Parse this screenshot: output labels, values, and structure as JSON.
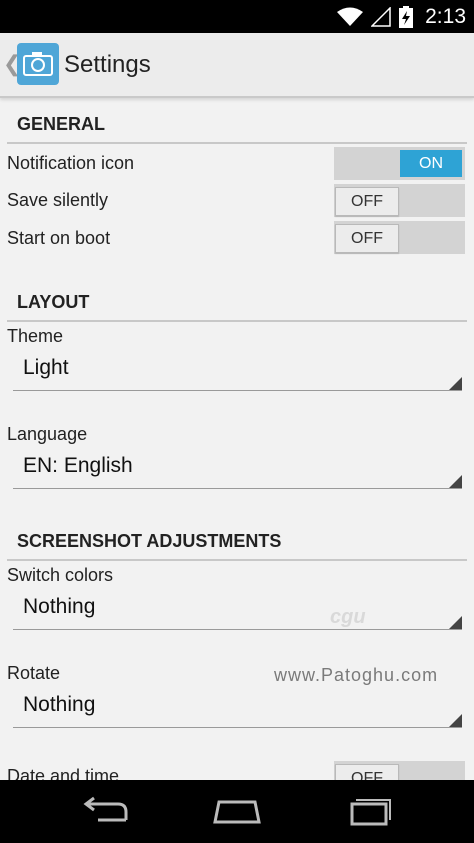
{
  "status_bar": {
    "time": "2:13",
    "icons": [
      "wifi-icon",
      "signal-icon",
      "battery-charging-icon"
    ]
  },
  "action_bar": {
    "title": "Settings",
    "app_icon": "camera-icon",
    "up_icon": "chevron-left-icon"
  },
  "sections": {
    "general": {
      "header": "GENERAL",
      "notification_icon": {
        "label": "Notification icon",
        "state": "ON"
      },
      "save_silently": {
        "label": "Save silently",
        "state": "OFF"
      },
      "start_on_boot": {
        "label": "Start on boot",
        "state": "OFF"
      }
    },
    "layout": {
      "header": "LAYOUT",
      "theme": {
        "label": "Theme",
        "value": "Light"
      },
      "language": {
        "label": "Language",
        "value": "EN: English"
      }
    },
    "adjustments": {
      "header": "SCREENSHOT ADJUSTMENTS",
      "switch_colors": {
        "label": "Switch colors",
        "value": "Nothing"
      },
      "rotate": {
        "label": "Rotate",
        "value": "Nothing"
      },
      "date_and_time": {
        "label": "Date and time",
        "state": "OFF"
      }
    }
  },
  "watermark": {
    "badge": "cgu",
    "text": "www.Patoghu.com"
  },
  "nav_bar": {
    "icons": [
      "back-icon",
      "home-icon",
      "recent-apps-icon"
    ]
  },
  "colors": {
    "accent": "#2ea3d5",
    "background": "#f2f2f2",
    "app_icon_bg": "#4fa6d7"
  }
}
